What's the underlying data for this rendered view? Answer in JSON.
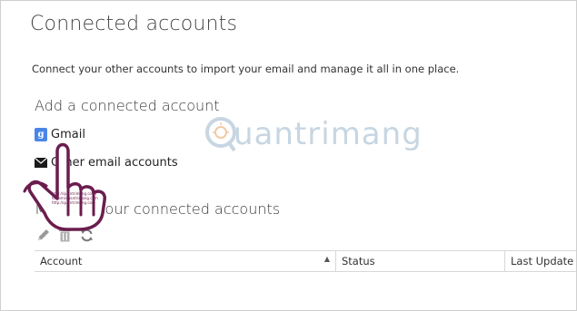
{
  "page": {
    "title": "Connected accounts",
    "description": "Connect your other accounts to import your email and manage it all in one place."
  },
  "add_section": {
    "heading": "Add a connected account",
    "gmail_label": "Gmail",
    "gmail_icon": "google-g-icon",
    "other_label": "Other email accounts",
    "other_icon": "envelope-icon"
  },
  "manage_section": {
    "heading": "Manage your connected accounts",
    "toolbar": {
      "edit_icon": "pencil-icon",
      "delete_icon": "trash-icon",
      "refresh_icon": "refresh-icon"
    },
    "table": {
      "columns": [
        "Account",
        "Status",
        "Last Update"
      ],
      "sorted_column": "Account",
      "sort_direction": "ascending"
    }
  },
  "overlay": {
    "watermark_text": "uantrimang",
    "cursor": "pointing-hand-icon"
  },
  "colors": {
    "google_blue": "#4a86e8",
    "watermark": "#9bb6cc",
    "border": "#d8d8d8"
  }
}
